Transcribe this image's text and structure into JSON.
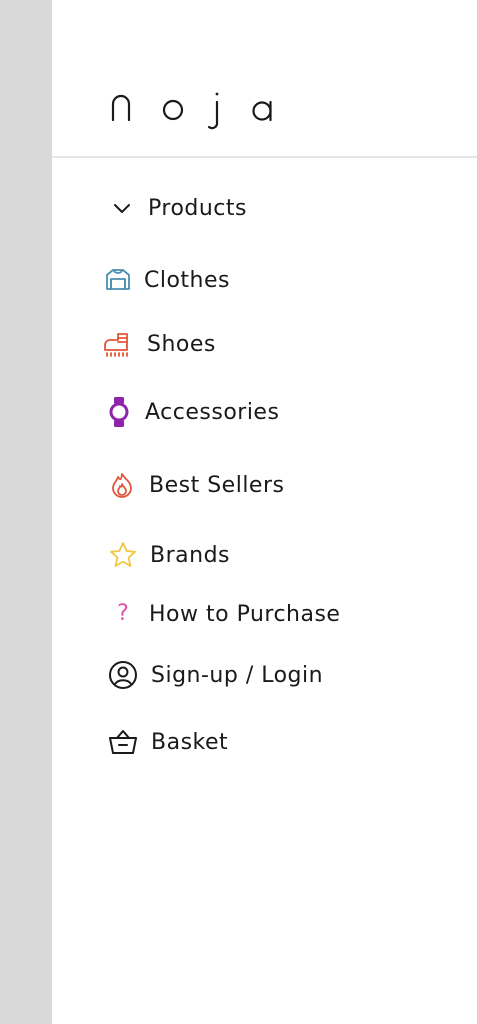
{
  "brand": {
    "logo_text": "noja"
  },
  "menu": {
    "products": {
      "label": "Products",
      "icon": "chevron-down-icon"
    },
    "items": [
      {
        "label": "Clothes",
        "icon": "sweater-icon",
        "color": "#4a8fb0"
      },
      {
        "label": "Shoes",
        "icon": "boot-icon",
        "color": "#e2553a"
      },
      {
        "label": "Accessories",
        "icon": "watch-icon",
        "color": "#8e24aa"
      },
      {
        "label": "Best Sellers",
        "icon": "flame-icon",
        "color": "#e2553a"
      },
      {
        "label": "Brands",
        "icon": "star-icon",
        "color": "#f2c744"
      },
      {
        "label": "How to Purchase",
        "icon": "question-icon",
        "color": "#e052a8"
      },
      {
        "label": "Sign-up / Login",
        "icon": "user-circle-icon",
        "color": "#1a1a1a"
      },
      {
        "label": "Basket",
        "icon": "basket-icon",
        "color": "#1a1a1a"
      }
    ]
  },
  "colors": {
    "left_strip": "#d9d9d9",
    "divider": "#e6e6e6",
    "text": "#1a1a1a"
  }
}
